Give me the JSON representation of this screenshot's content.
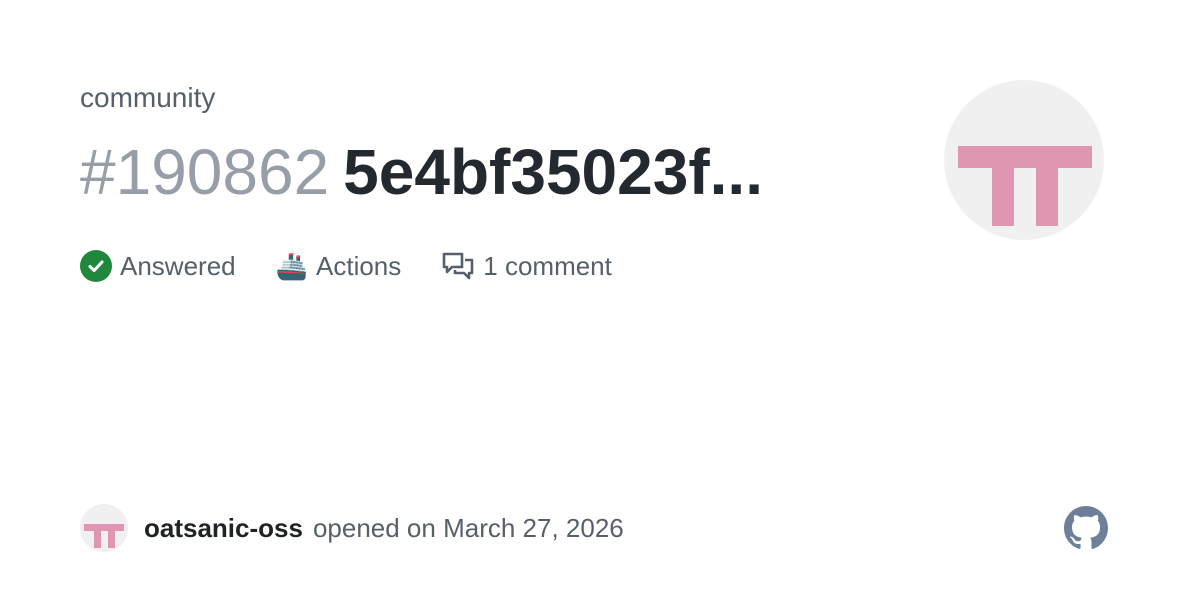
{
  "repo": {
    "name": "community"
  },
  "issue": {
    "number": "#190862",
    "title": "5e4bf35023f..."
  },
  "meta": {
    "status_label": "Answered",
    "category_emoji": "🚢",
    "category_label": "Actions",
    "comments_label": "1 comment"
  },
  "footer": {
    "author": "oatsanic-oss",
    "opened_text": "opened on March 27, 2026"
  },
  "colors": {
    "answered_green": "#1f883d",
    "avatar_pink": "#e096b2",
    "muted_text": "#57606a",
    "title_text": "#24292f",
    "number_text": "#979ea8",
    "github_logo": "#6e7f9a"
  },
  "icons": {
    "status": "check-circle-icon",
    "comments": "comment-discussion-icon",
    "brand": "github-mark-icon"
  }
}
